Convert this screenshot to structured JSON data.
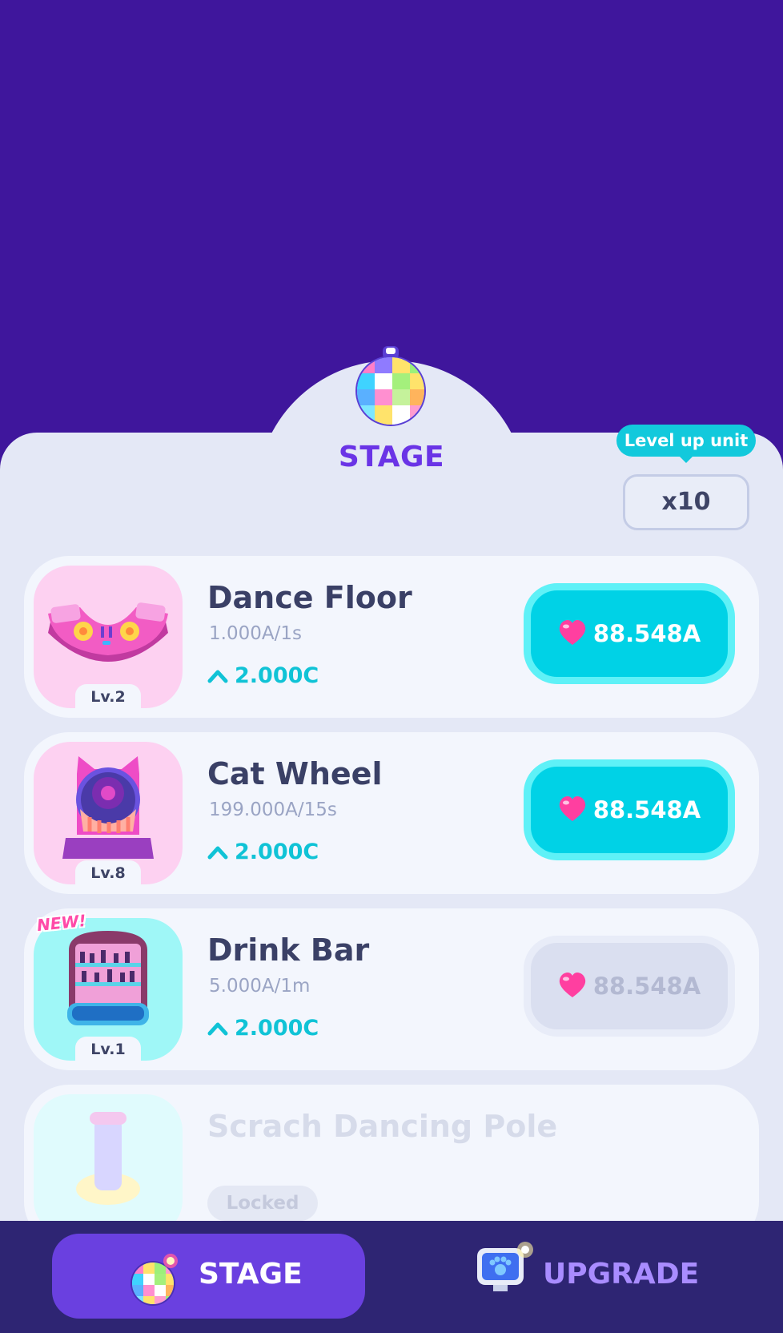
{
  "header": {
    "title": "STAGE",
    "level_up_tip": "Level up unit",
    "level_up_unit": "x10"
  },
  "items": [
    {
      "name": "Dance Floor",
      "rate": "1.000A/1s",
      "gain": "2.000C",
      "level": "Lv.2",
      "price": "88.548A",
      "state": "enabled",
      "icon": "dance-floor-icon"
    },
    {
      "name": "Cat Wheel",
      "rate": "199.000A/15s",
      "gain": "2.000C",
      "level": "Lv.8",
      "price": "88.548A",
      "state": "enabled",
      "icon": "cat-wheel-icon"
    },
    {
      "name": "Drink Bar",
      "rate": "5.000A/1m",
      "gain": "2.000C",
      "level": "Lv.1",
      "price": "88.548A",
      "state": "disabled",
      "badge": "NEW!",
      "icon": "drink-bar-icon"
    },
    {
      "name": "Scrach Dancing Pole",
      "status": "Locked",
      "state": "locked",
      "icon": "dancing-pole-icon"
    }
  ],
  "nav": {
    "stage_label": "STAGE",
    "upgrade_label": "UPGRADE"
  },
  "colors": {
    "background": "#3f169c",
    "accent": "#00d2e6",
    "primary": "#6a40e0",
    "heart": "#ff3fa0"
  }
}
